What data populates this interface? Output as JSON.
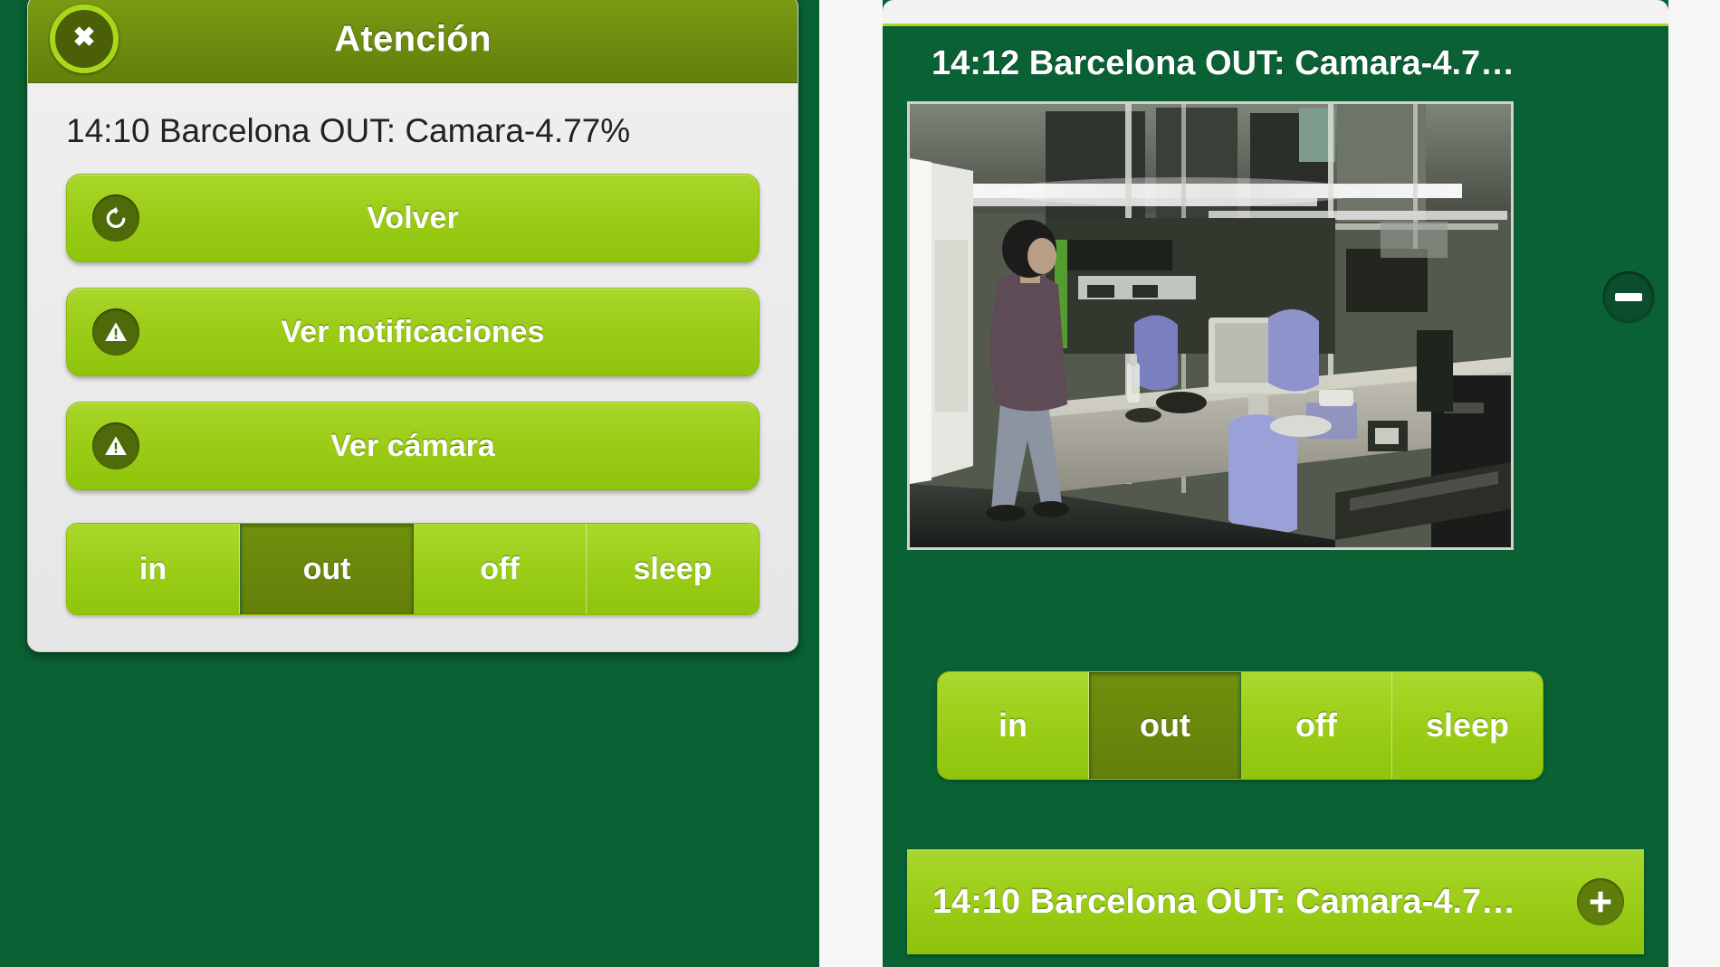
{
  "colors": {
    "panel_bg": "#0a6234",
    "accent_lime": "#9ccd18",
    "header_olive": "#6c8a0e",
    "selected_olive": "#6f900d",
    "dialog_bg": "#e8e8e8",
    "text_white": "#ffffff",
    "text_dark": "#222222"
  },
  "dialog": {
    "title": "Atención",
    "close_icon": "close-x-icon",
    "alert_text": "14:10 Barcelona OUT: Camara-4.77%",
    "buttons": [
      {
        "label": "Volver",
        "icon": "undo-arrow-icon"
      },
      {
        "label": "Ver notificaciones",
        "icon": "warning-triangle-icon"
      },
      {
        "label": "Ver cámara",
        "icon": "warning-triangle-icon"
      }
    ],
    "mode_selector": {
      "options": [
        "in",
        "out",
        "off",
        "sleep"
      ],
      "selected": "out"
    }
  },
  "camera_panel": {
    "header_title": "14:12 Barcelona OUT: Camara-4.7…",
    "collapse_icon": "minus-circle-icon",
    "camera_view_alt": "cctv-office-view",
    "mode_selector": {
      "options": [
        "in",
        "out",
        "off",
        "sleep"
      ],
      "selected": "out"
    },
    "footer_title": "14:10 Barcelona OUT: Camara-4.7…",
    "expand_icon": "plus-circle-icon"
  }
}
